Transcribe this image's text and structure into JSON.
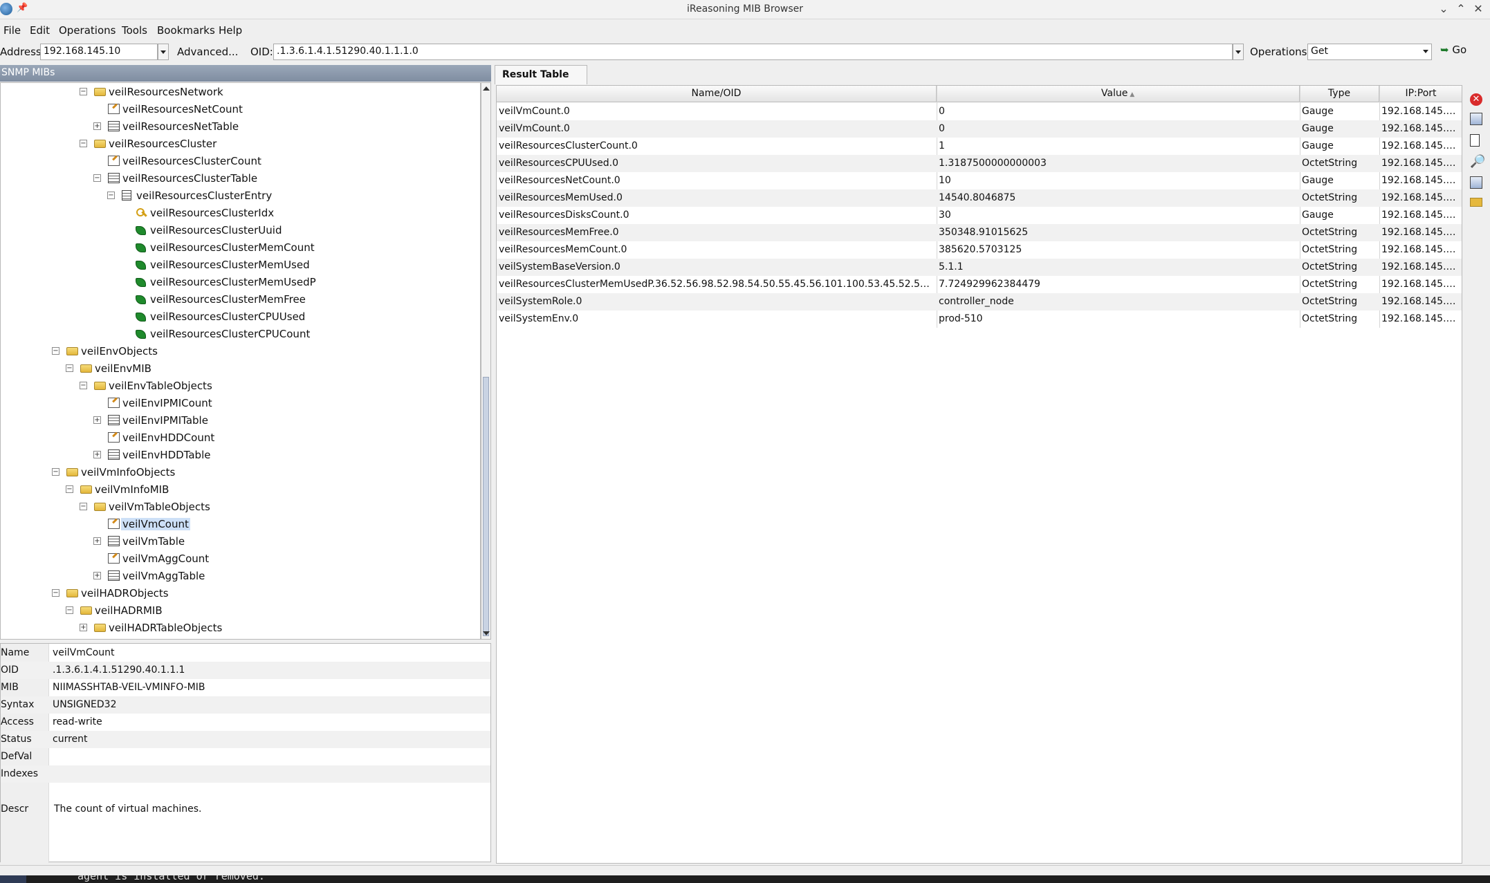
{
  "window": {
    "title": "iReasoning MIB Browser"
  },
  "menu": [
    "File",
    "Edit",
    "Operations",
    "Tools",
    "Bookmarks",
    "Help"
  ],
  "toolbar": {
    "address_label": "Address:",
    "address_value": "192.168.145.10",
    "advanced_label": "Advanced...",
    "oid_label": "OID:",
    "oid_value": ".1.3.6.1.4.1.51290.40.1.1.1.0",
    "operations_label": "Operations:",
    "operations_value": "Get",
    "go_label": "Go"
  },
  "left_panel": {
    "title": "SNMP MIBs"
  },
  "tree": [
    {
      "label": "veilResourcesNetwork",
      "icon": "folder-icon",
      "expander": "minus"
    },
    {
      "label": "veilResourcesNetCount",
      "icon": "scalar-icon"
    },
    {
      "label": "veilResourcesNetTable",
      "icon": "table-icon",
      "expander": "plus"
    },
    {
      "label": "veilResourcesCluster",
      "icon": "folder-icon",
      "expander": "minus"
    },
    {
      "label": "veilResourcesClusterCount",
      "icon": "scalar-icon"
    },
    {
      "label": "veilResourcesClusterTable",
      "icon": "table-icon",
      "expander": "minus"
    },
    {
      "label": "veilResourcesClusterEntry",
      "icon": "entry-icon",
      "expander": "minus"
    },
    {
      "label": "veilResourcesClusterIdx",
      "icon": "key-icon"
    },
    {
      "label": "veilResourcesClusterUuid",
      "icon": "leaf-icon"
    },
    {
      "label": "veilResourcesClusterMemCount",
      "icon": "leaf-icon"
    },
    {
      "label": "veilResourcesClusterMemUsed",
      "icon": "leaf-icon"
    },
    {
      "label": "veilResourcesClusterMemUsedP",
      "icon": "leaf-icon"
    },
    {
      "label": "veilResourcesClusterMemFree",
      "icon": "leaf-icon"
    },
    {
      "label": "veilResourcesClusterCPUUsed",
      "icon": "leaf-icon"
    },
    {
      "label": "veilResourcesClusterCPUCount",
      "icon": "leaf-icon"
    },
    {
      "label": "veilEnvObjects",
      "icon": "folder-icon",
      "expander": "minus"
    },
    {
      "label": "veilEnvMIB",
      "icon": "folder-icon",
      "expander": "minus"
    },
    {
      "label": "veilEnvTableObjects",
      "icon": "folder-icon",
      "expander": "minus"
    },
    {
      "label": "veilEnvIPMICount",
      "icon": "scalar-icon"
    },
    {
      "label": "veilEnvIPMITable",
      "icon": "table-icon",
      "expander": "plus"
    },
    {
      "label": "veilEnvHDDCount",
      "icon": "scalar-icon"
    },
    {
      "label": "veilEnvHDDTable",
      "icon": "table-icon",
      "expander": "plus"
    },
    {
      "label": "veilVmInfoObjects",
      "icon": "folder-icon",
      "expander": "minus"
    },
    {
      "label": "veilVmInfoMIB",
      "icon": "folder-icon",
      "expander": "minus"
    },
    {
      "label": "veilVmTableObjects",
      "icon": "folder-icon",
      "expander": "minus"
    },
    {
      "label": "veilVmCount",
      "icon": "scalar-icon",
      "selected": true
    },
    {
      "label": "veilVmTable",
      "icon": "table-icon",
      "expander": "plus"
    },
    {
      "label": "veilVmAggCount",
      "icon": "scalar-icon"
    },
    {
      "label": "veilVmAggTable",
      "icon": "table-icon",
      "expander": "plus"
    },
    {
      "label": "veilHADRObjects",
      "icon": "folder-icon",
      "expander": "minus"
    },
    {
      "label": "veilHADRMIB",
      "icon": "folder-icon",
      "expander": "minus"
    },
    {
      "label": "veilHADRTableObjects",
      "icon": "folder-icon",
      "expander": "plus"
    }
  ],
  "properties": [
    {
      "key": "Name",
      "value": "veilVmCount"
    },
    {
      "key": "OID",
      "value": ".1.3.6.1.4.1.51290.40.1.1.1"
    },
    {
      "key": "MIB",
      "value": "NIIMASSHTAB-VEIL-VMINFO-MIB"
    },
    {
      "key": "Syntax",
      "value": "UNSIGNED32"
    },
    {
      "key": "Access",
      "value": "read-write"
    },
    {
      "key": "Status",
      "value": "current"
    },
    {
      "key": "DefVal",
      "value": ""
    },
    {
      "key": "Indexes",
      "value": ""
    },
    {
      "key": "Descr",
      "value": "The count of virtual machines."
    }
  ],
  "result_tab": {
    "label": "Result Table"
  },
  "result_columns": [
    "Name/OID",
    "Value",
    "Type",
    "IP:Port"
  ],
  "result_rows": [
    [
      "veilVmCount.0",
      "0",
      "Gauge",
      "192.168.145.10:..."
    ],
    [
      "veilVmCount.0",
      "0",
      "Gauge",
      "192.168.145.10:..."
    ],
    [
      "veilResourcesClusterCount.0",
      "1",
      "Gauge",
      "192.168.145.10:..."
    ],
    [
      "veilResourcesCPUUsed.0",
      "1.3187500000000003",
      "OctetString",
      "192.168.145.10:..."
    ],
    [
      "veilResourcesNetCount.0",
      "10",
      "Gauge",
      "192.168.145.10:..."
    ],
    [
      "veilResourcesMemUsed.0",
      "14540.8046875",
      "OctetString",
      "192.168.145.10:..."
    ],
    [
      "veilResourcesDisksCount.0",
      "30",
      "Gauge",
      "192.168.145.10:..."
    ],
    [
      "veilResourcesMemFree.0",
      "350348.91015625",
      "OctetString",
      "192.168.145.10:..."
    ],
    [
      "veilResourcesMemCount.0",
      "385620.5703125",
      "OctetString",
      "192.168.145.10:..."
    ],
    [
      "veilSystemBaseVersion.0",
      "5.1.1",
      "OctetString",
      "192.168.145.10:..."
    ],
    [
      "veilResourcesClusterMemUsedP.36.52.56.98.52.98.54.50.55.45.56.101.100.53.45.52.51.100.56...",
      "7.724929962384479",
      "OctetString",
      "192.168.145.10:..."
    ],
    [
      "veilSystemRole.0",
      "controller_node",
      "OctetString",
      "192.168.145.10:..."
    ],
    [
      "veilSystemEnv.0",
      "prod-510",
      "OctetString",
      "192.168.145.10:..."
    ]
  ],
  "terminal_text": "agent is installed or removed."
}
